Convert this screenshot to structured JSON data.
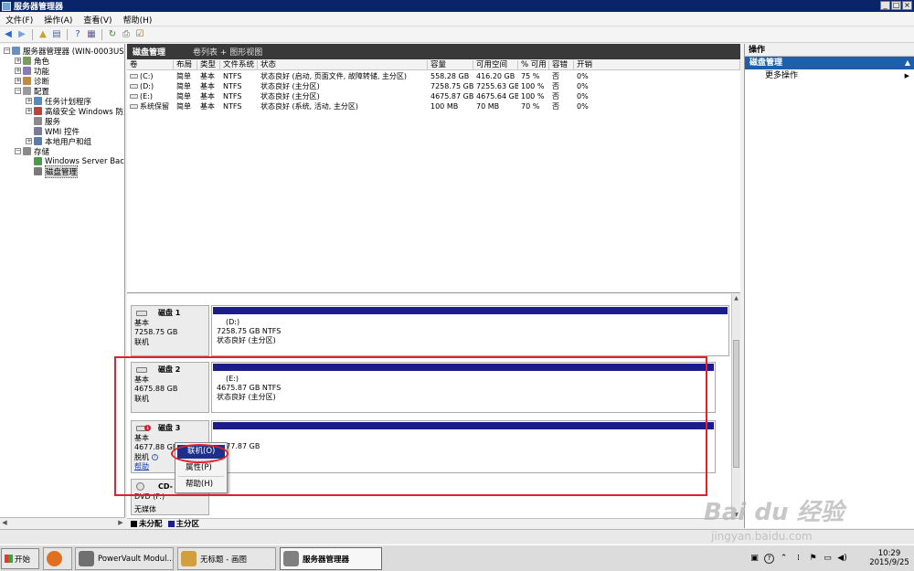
{
  "window": {
    "title": "服务器管理器"
  },
  "menus": [
    "文件(F)",
    "操作(A)",
    "查看(V)",
    "帮助(H)"
  ],
  "tree": [
    {
      "label": "服务器管理器 (WIN-0003USKTL5",
      "indent": 0,
      "exp": "−",
      "icon": "server-icon",
      "color": "#6a8fbf"
    },
    {
      "label": "角色",
      "indent": 1,
      "exp": "+",
      "icon": "roles-icon",
      "color": "#7a9a60"
    },
    {
      "label": "功能",
      "indent": 1,
      "exp": "+",
      "icon": "features-icon",
      "color": "#8a7ab5"
    },
    {
      "label": "诊断",
      "indent": 1,
      "exp": "+",
      "icon": "diagnostics-icon",
      "color": "#c08a40"
    },
    {
      "label": "配置",
      "indent": 1,
      "exp": "−",
      "icon": "configuration-icon",
      "color": "#9a9a9a"
    },
    {
      "label": "任务计划程序",
      "indent": 2,
      "exp": "+",
      "icon": "task-scheduler-icon",
      "color": "#5a8ac0"
    },
    {
      "label": "高级安全 Windows 防火墙",
      "indent": 2,
      "exp": "+",
      "icon": "firewall-icon",
      "color": "#c04040"
    },
    {
      "label": "服务",
      "indent": 2,
      "exp": "",
      "icon": "services-icon",
      "color": "#8a8a8a"
    },
    {
      "label": "WMI 控件",
      "indent": 2,
      "exp": "",
      "icon": "wmi-icon",
      "color": "#7a7a9a"
    },
    {
      "label": "本地用户和组",
      "indent": 2,
      "exp": "+",
      "icon": "users-icon",
      "color": "#5a7ab0"
    },
    {
      "label": "存储",
      "indent": 1,
      "exp": "−",
      "icon": "storage-icon",
      "color": "#8a8a8a"
    },
    {
      "label": "Windows Server Backup",
      "indent": 2,
      "exp": "",
      "icon": "backup-icon",
      "color": "#4a9a4a"
    },
    {
      "label": "磁盘管理",
      "indent": 2,
      "exp": "",
      "icon": "disk-management-icon",
      "color": "#7a7a7a",
      "selected": true
    }
  ],
  "center_header": {
    "title": "磁盘管理",
    "views": "卷列表 + 图形视图"
  },
  "volume_table": {
    "columns": [
      "卷",
      "布局",
      "类型",
      "文件系统",
      "状态",
      "容量",
      "可用空间",
      "% 可用",
      "容错",
      "开销"
    ],
    "rows": [
      [
        "(C:)",
        "简单",
        "基本",
        "NTFS",
        "状态良好 (启动, 页面文件, 故障转储, 主分区)",
        "558.28 GB",
        "416.20 GB",
        "75 %",
        "否",
        "0%"
      ],
      [
        "(D:)",
        "简单",
        "基本",
        "NTFS",
        "状态良好 (主分区)",
        "7258.75 GB",
        "7255.63 GB",
        "100 %",
        "否",
        "0%"
      ],
      [
        "(E:)",
        "简单",
        "基本",
        "NTFS",
        "状态良好 (主分区)",
        "4675.87 GB",
        "4675.64 GB",
        "100 %",
        "否",
        "0%"
      ],
      [
        "系统保留",
        "简单",
        "基本",
        "NTFS",
        "状态良好 (系统, 活动, 主分区)",
        "100 MB",
        "70 MB",
        "70 %",
        "否",
        "0%"
      ]
    ]
  },
  "disks": [
    {
      "name": "磁盘 1",
      "type": "基本",
      "size": "7258.75 GB",
      "status": "联机",
      "part_label": "(D:)",
      "part_size": "7258.75 GB NTFS",
      "part_status": "状态良好 (主分区)"
    },
    {
      "name": "磁盘 2",
      "type": "基本",
      "size": "4675.88 GB",
      "status": "联机",
      "part_label": "(E:)",
      "part_size": "4675.87 GB NTFS",
      "part_status": "状态良好 (主分区)"
    },
    {
      "name": "磁盘 3",
      "type": "基本",
      "size": "4677.88 GB",
      "status": "脱机",
      "help": "帮助",
      "part_size": "4677.87 GB"
    }
  ],
  "cdrom": {
    "name": "CD-",
    "line2": "DVD (F:)",
    "line3": "无媒体"
  },
  "legend": [
    {
      "label": "未分配",
      "color": "#000000"
    },
    {
      "label": "主分区",
      "color": "#1c1c8a"
    }
  ],
  "context_menu": [
    {
      "label": "联机(O)",
      "active": true
    },
    {
      "label": "属性(P)",
      "active": false
    },
    {
      "label": "帮助(H)",
      "active": false
    }
  ],
  "actions": {
    "header": "操作",
    "section": "磁盘管理",
    "items": [
      "更多操作"
    ]
  },
  "taskbar": {
    "start": "开始",
    "tasks": [
      {
        "label": "",
        "color": "#e07020"
      },
      {
        "label": "PowerVault Modul...",
        "color": "#707070"
      },
      {
        "label": "无标题 - 画图",
        "color": "#d0a040"
      },
      {
        "label": "服务器管理器",
        "color": "#808080"
      }
    ],
    "time": "10:29",
    "date": "2015/9/25"
  },
  "watermark": {
    "main": "Bai du 经验",
    "sub": "jingyan.baidu.com"
  },
  "colors": {
    "titlebar": "#0a246a",
    "partition_bar": "#1c1c8a",
    "selection": "#1f5ea8",
    "highlight_red": "#e0202a"
  }
}
